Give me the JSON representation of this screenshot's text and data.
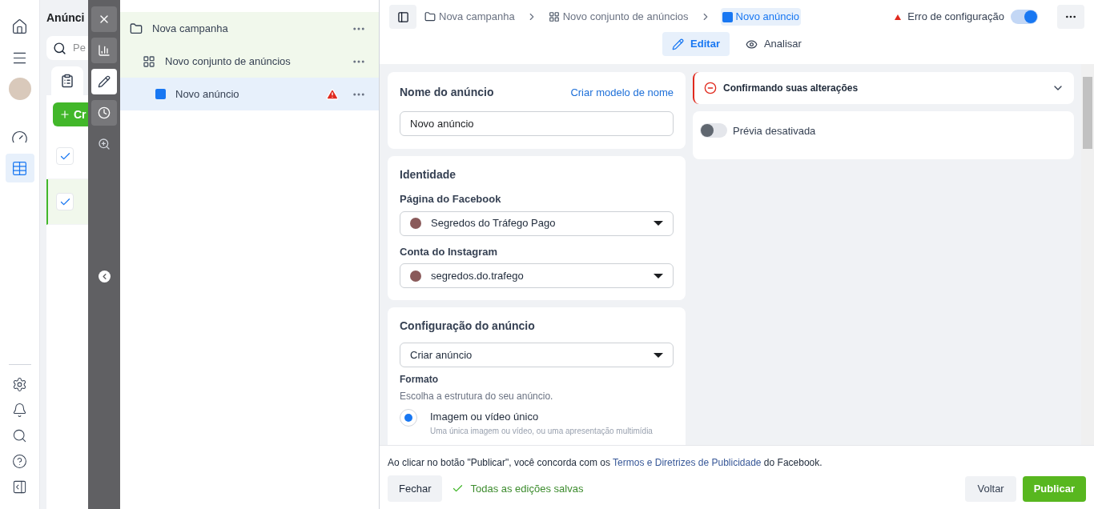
{
  "nav": {
    "top": [
      {
        "kind": "home",
        "selected": false
      },
      {
        "kind": "menu",
        "selected": false
      },
      {
        "kind": "avatar",
        "selected": false
      },
      {
        "kind": "gauge",
        "selected": false
      },
      {
        "kind": "table",
        "selected": true
      }
    ],
    "bottom": [
      {
        "kind": "settings"
      },
      {
        "kind": "bell"
      },
      {
        "kind": "search"
      },
      {
        "kind": "help"
      },
      {
        "kind": "panel"
      }
    ]
  },
  "background_panel": {
    "title": "Anúnci",
    "search": {
      "placeholder": "Pe"
    },
    "create_button": "Cr",
    "rows": [
      {
        "checked": true,
        "selected": false
      },
      {
        "checked": true,
        "selected": true
      }
    ]
  },
  "tool_strip": [
    {
      "kind": "close",
      "selected": false
    },
    {
      "kind": "chart",
      "selected": false
    },
    {
      "kind": "pencil",
      "selected": true
    },
    {
      "kind": "clock",
      "selected": false
    },
    {
      "kind": "zoom",
      "selected": false
    }
  ],
  "tree": [
    {
      "label": "Nova campanha",
      "kind": "campaign",
      "selected": false,
      "warning": false,
      "children": [
        {
          "label": "Novo conjunto de anúncios",
          "kind": "adset",
          "selected": false,
          "warning": false,
          "children": [
            {
              "label": "Novo anúncio",
              "kind": "ad",
              "selected": true,
              "warning": true
            }
          ]
        }
      ]
    }
  ],
  "breadcrumbs": [
    {
      "label": "Nova campanha",
      "kind": "campaign",
      "selected": false
    },
    {
      "label": "Novo conjunto de anúncios",
      "kind": "adset",
      "selected": false
    },
    {
      "label": "Novo anúncio",
      "kind": "ad",
      "selected": true
    }
  ],
  "status": {
    "error": "Erro de configuração",
    "toggle_on": true
  },
  "tabs": [
    {
      "label": "Editar",
      "kind": "edit",
      "selected": true
    },
    {
      "label": "Analisar",
      "kind": "review",
      "selected": false
    }
  ],
  "ad_name": {
    "title": "Nome do anúncio",
    "link": "Criar modelo de nome",
    "value": "Novo anúncio"
  },
  "identity": {
    "title": "Identidade",
    "fields": [
      {
        "label": "Página do Facebook",
        "value": "Segredos do Tráfego Pago"
      },
      {
        "label": "Conta do Instagram",
        "value": "segredos.do.trafego"
      }
    ]
  },
  "ad_setup": {
    "title": "Configuração do anúncio",
    "select": "Criar anúncio",
    "format_title": "Formato",
    "format_hint": "Escolha a estrutura do seu anúncio.",
    "options": [
      {
        "label": "Imagem ou vídeo único",
        "description": "Uma única imagem ou vídeo, ou uma apresentação multimídia",
        "selected": true
      }
    ]
  },
  "alert": {
    "title": "Confirmando suas alterações",
    "expanded": false
  },
  "preview": {
    "label": "Prévia desativada",
    "on": false
  },
  "footer": {
    "terms_before": "Ao clicar no botão \"Publicar\", você concorda com os ",
    "terms_link": "Termos e Diretrizes de Publicidade",
    "terms_after": " do Facebook.",
    "close": "Fechar",
    "saved": "Todas as edições salvas",
    "back": "Voltar",
    "publish": "Publicar"
  }
}
